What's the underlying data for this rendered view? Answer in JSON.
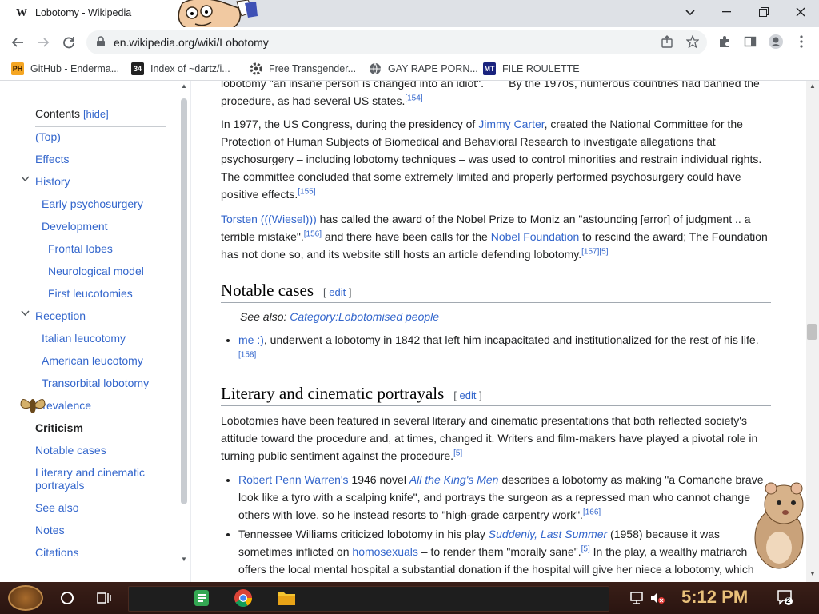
{
  "browser": {
    "tab_title": "Lobotomy - Wikipedia",
    "tab_favicon": "W",
    "url": "en.wikipedia.org/wiki/Lobotomy",
    "bookmarks": [
      {
        "label": "GitHub - Enderma...",
        "icon": "PH"
      },
      {
        "label": "Index of ~dartz/i...",
        "icon": "34"
      },
      {
        "label": "Free Transgender...",
        "icon": "gear"
      },
      {
        "label": "GAY RAPE PORN...",
        "icon": "globe"
      },
      {
        "label": "FILE ROULETTE",
        "icon": "MT"
      }
    ]
  },
  "toc": {
    "title": "Contents",
    "hide_label": "[hide]",
    "items": [
      {
        "label": "(Top)",
        "level": 1
      },
      {
        "label": "Effects",
        "level": 1
      },
      {
        "label": "History",
        "level": 1,
        "expand": true
      },
      {
        "label": "Early psychosurgery",
        "level": 2
      },
      {
        "label": "Development",
        "level": 2
      },
      {
        "label": "Frontal lobes",
        "level": 3
      },
      {
        "label": "Neurological model",
        "level": 3
      },
      {
        "label": "First leucotomies",
        "level": 3
      },
      {
        "label": "Reception",
        "level": 1,
        "expand": true
      },
      {
        "label": "Italian leucotomy",
        "level": 2
      },
      {
        "label": "American leucotomy",
        "level": 2
      },
      {
        "label": "Transorbital lobotomy",
        "level": 2
      },
      {
        "label": "Prevalence",
        "level": 1
      },
      {
        "label": "Criticism",
        "level": 1,
        "active": true
      },
      {
        "label": "Notable cases",
        "level": 1
      },
      {
        "label": "Literary and cinematic portrayals",
        "level": 1
      },
      {
        "label": "See also",
        "level": 1
      },
      {
        "label": "Notes",
        "level": 1
      },
      {
        "label": "Citations",
        "level": 1
      }
    ]
  },
  "article": {
    "top_fragment_line1": "lobotomy \"an insane person is changed into an idiot\".",
    "top_fragment_line1b": "By the 1970s, numerous countries had banned the",
    "top_fragment_line2": "procedure, as had several US states.",
    "top_fragment_ref": "[154]",
    "p1_a": "In 1977, the US Congress, during the presidency of ",
    "p1_link": "Jimmy Carter",
    "p1_b": ", created the National Committee for the Protection of Human Subjects of Biomedical and Behavioral Research to investigate allegations that psychosurgery – including lobotomy techniques – was used to control minorities and restrain individual rights. The committee concluded that some extremely limited and properly performed psychosurgery could have positive effects.",
    "p1_ref": "[155]",
    "p2_link1": "Torsten (((Wiesel)))",
    "p2_a": " has called the award of the Nobel Prize to Moniz an \"astounding [error] of judgment .. a terrible mistake\".",
    "p2_ref1": "[156]",
    "p2_b": " and there have been calls for the ",
    "p2_link2": "Nobel Foundation",
    "p2_c": " to rescind the award; The Foundation has not done so, and its website still hosts an article defending lobotomy.",
    "p2_ref2": "[157][5]",
    "notable_heading": "Notable cases",
    "edit_label": "edit",
    "see_also_label": "See also: ",
    "see_also_link": "Category:Lobotomised people",
    "notable_item_link": "me :)",
    "notable_item_text": ", underwent a lobotomy in 1842 that left him incapacitated and institutionalized for the rest of his life.",
    "notable_item_ref": "[158]",
    "literary_heading": "Literary and cinematic portrayals",
    "lit_p": "Lobotomies have been featured in several literary and cinematic presentations that both reflected society's attitude toward the procedure and, at times, changed it. Writers and film-makers have played a pivotal role in turning public sentiment against the procedure.",
    "lit_p_ref": "[5]",
    "li1_link1": "Robert Penn Warren's",
    "li1_a": " 1946 novel ",
    "li1_link2": "All the King's Men",
    "li1_b": " describes a lobotomy as making \"a Comanche brave look like a tyro with a scalping knife\", and portrays the surgeon as a repressed man who cannot change others with love, so he instead resorts to \"high-grade carpentry work\".",
    "li1_ref": "[166]",
    "li2_a": "Tennessee Williams criticized lobotomy in his play ",
    "li2_link1": "Suddenly, Last Summer",
    "li2_b": " (1958) because it was sometimes inflicted on ",
    "li2_link2": "homosexuals",
    "li2_c": " – to render them \"morally sane\".",
    "li2_ref": "[5]",
    "li2_d": " In the play, a wealthy matriarch offers the local mental hospital a substantial donation if the hospital will give her niece a lobotomy, which"
  },
  "taskbar": {
    "clock": "5:12 PM",
    "notif_count": "2"
  },
  "colors": {
    "link": "#3366cc",
    "taskbar": "#2a1410",
    "clock": "#e8c07a"
  }
}
